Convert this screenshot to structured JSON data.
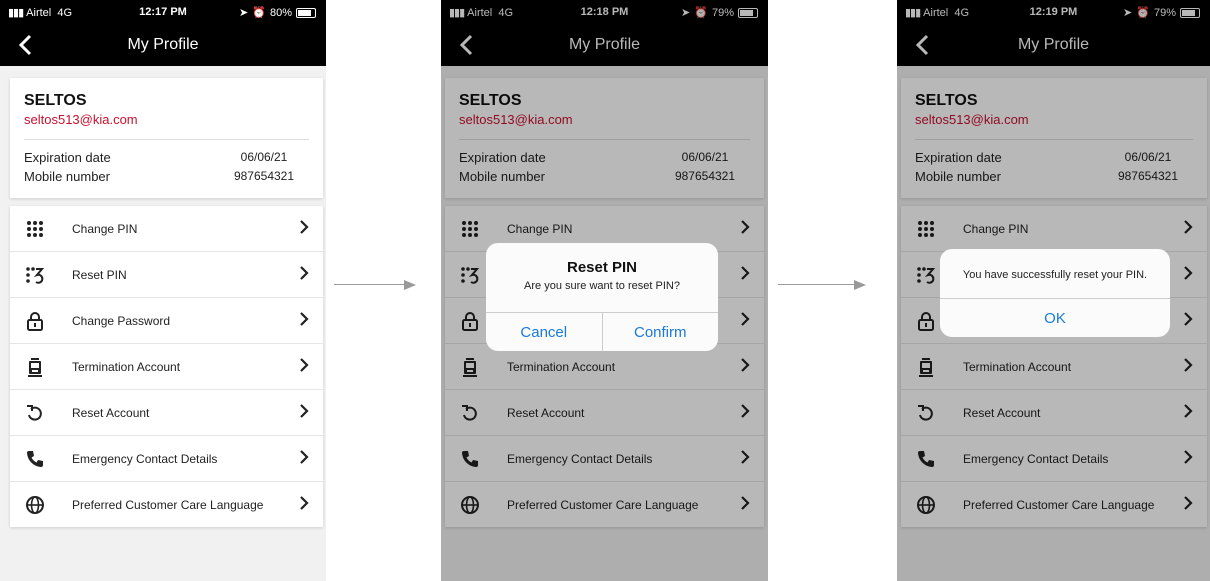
{
  "status_bars": [
    {
      "carrier": "Airtel",
      "network": "4G",
      "time": "12:17 PM",
      "battery": "80%"
    },
    {
      "carrier": "Airtel",
      "network": "4G",
      "time": "12:18 PM",
      "battery": "79%"
    },
    {
      "carrier": "Airtel",
      "network": "4G",
      "time": "12:19 PM",
      "battery": "79%"
    }
  ],
  "nav": {
    "title": "My Profile"
  },
  "profile": {
    "name": "SELTOS",
    "email": "seltos513@kia.com",
    "expiration_label": "Expiration date",
    "expiration_value": "06/06/21",
    "mobile_label": "Mobile number",
    "mobile_value": "987654321"
  },
  "menu": [
    {
      "label": "Change PIN",
      "icon": "keypad-icon"
    },
    {
      "label": "Reset PIN",
      "icon": "reset-pin-icon"
    },
    {
      "label": "Change Password",
      "icon": "lock-icon"
    },
    {
      "label": "Termination Account",
      "icon": "id-card-icon"
    },
    {
      "label": "Reset Account",
      "icon": "reset-icon"
    },
    {
      "label": "Emergency Contact Details",
      "icon": "phone-icon"
    },
    {
      "label": "Preferred Customer Care Language",
      "icon": "globe-icon"
    }
  ],
  "confirm_dialog": {
    "title": "Reset PIN",
    "message": "Are you sure want to reset PIN?",
    "cancel": "Cancel",
    "confirm": "Confirm"
  },
  "success_dialog": {
    "message": "You have successfully reset your PIN.",
    "ok": "OK"
  },
  "colors": {
    "accent": "#1a7ad9",
    "email": "#c8102e",
    "bar": "#000000"
  }
}
